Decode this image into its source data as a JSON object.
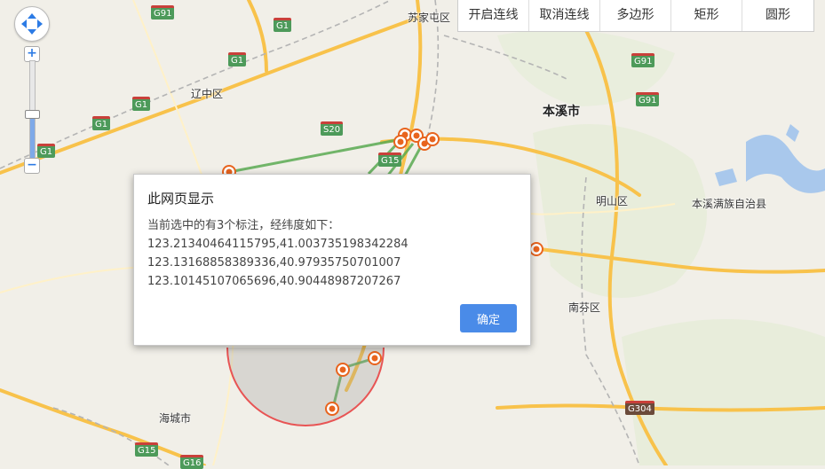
{
  "toolbar": {
    "buttons": [
      "开启连线",
      "取消连线",
      "多边形",
      "矩形",
      "圆形"
    ]
  },
  "map_labels": {
    "sujiatun": "苏家屯区",
    "liaozhong": "辽中区",
    "benxi": "本溪市",
    "mingshan": "明山区",
    "benxi_manchu": "本溪满族自治县",
    "nanfen": "南芬区",
    "haicheng": "海城市"
  },
  "road_shields": {
    "g91_a": "G91",
    "g1_a": "G1",
    "g1_b": "G1",
    "g1_c": "G1",
    "g1_d": "G1",
    "g1_e": "G1",
    "g91_b": "G91",
    "g91_c": "G91",
    "s20": "S20",
    "g15_a": "G15",
    "g304": "G304",
    "g15_b": "G15",
    "g16": "G16"
  },
  "zoom": {
    "in_symbol": "+",
    "out_symbol": "−",
    "level_fraction": 0.5
  },
  "dialog": {
    "title": "此网页显示",
    "message": "当前选中的有3个标注，经纬度如下：",
    "coords": [
      "123.21340464115795,41.003735198342284",
      "123.13168858389336,40.97935750701007",
      "123.10145107065696,40.90448987207267"
    ],
    "ok_label": "确定"
  },
  "colors": {
    "marker": "#e8641e",
    "line": "#5aaa52",
    "circle_stroke": "#e85454",
    "button": "#4a8be8"
  }
}
